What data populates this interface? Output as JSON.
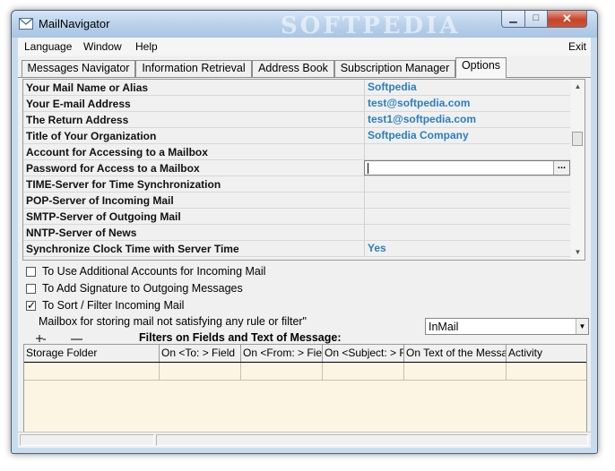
{
  "window": {
    "title": "MailNavigator",
    "watermark": "SOFTPEDIA"
  },
  "title_buttons": {
    "minimize": "▁",
    "maximize": "□",
    "close": "✕"
  },
  "menu": {
    "items": [
      "Language",
      "Window",
      "Help"
    ],
    "exit": "Exit"
  },
  "tabs": [
    {
      "label": "Messages Navigator",
      "active": false
    },
    {
      "label": "Information Retrieval",
      "active": false
    },
    {
      "label": "Address Book",
      "active": false
    },
    {
      "label": "Subscription Manager",
      "active": false
    },
    {
      "label": "Options",
      "active": true
    }
  ],
  "options_grid": {
    "rows": [
      {
        "name": "Your Mail Name or Alias",
        "value": "Softpedia"
      },
      {
        "name": "Your E-mail Address",
        "value": "test@softpedia.com"
      },
      {
        "name": "The Return Address",
        "value": "test1@softpedia.com"
      },
      {
        "name": "Title of Your Organization",
        "value": "Softpedia Company"
      },
      {
        "name": "Account for Accessing to a Mailbox",
        "value": ""
      },
      {
        "name": "Password for Access to a Mailbox",
        "value": ""
      },
      {
        "name": "TIME-Server for Time Synchronization",
        "value": ""
      },
      {
        "name": "POP-Server of Incoming Mail",
        "value": ""
      },
      {
        "name": "SMTP-Server of Outgoing Mail",
        "value": ""
      },
      {
        "name": "NNTP-Server of News",
        "value": ""
      },
      {
        "name": "Synchronize Clock Time with Server Time",
        "value": "Yes"
      }
    ],
    "ellipsis_label": "..."
  },
  "checkboxes": [
    {
      "label": "To Use Additional Accounts for Incoming Mail",
      "checked": false
    },
    {
      "label": "To Add Signature to Outgoing Messages",
      "checked": false
    },
    {
      "label": "To Sort / Filter Incoming Mail",
      "checked": true
    }
  ],
  "checkmark": "✓",
  "mailbox_label": "Mailbox for storing mail not satisfying any rule or filter\"",
  "mailbox_combo": {
    "value": "InMail"
  },
  "filters_label": "Filters on Fields and Text of Message:",
  "filter_table": {
    "columns": [
      "Storage Folder",
      "On <To: > Field",
      "On <From: > Field",
      "On <Subject: > Field",
      "On Text of the Message",
      "Activity"
    ]
  },
  "colors": {
    "value_text": "#2a7fc0",
    "filter_table_bg": "#fcf5e3",
    "title_bar": "#b8d0e9"
  }
}
